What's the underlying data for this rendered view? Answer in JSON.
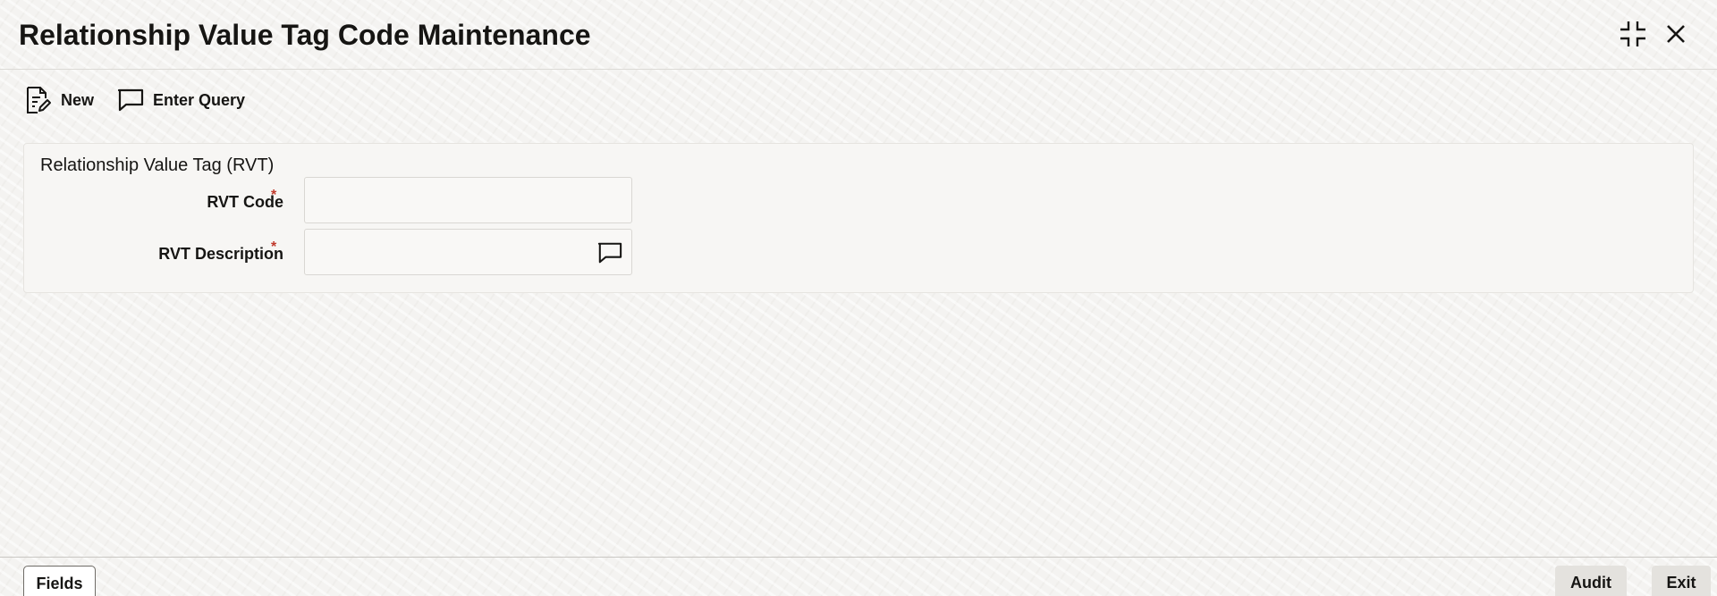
{
  "window": {
    "title": "Relationship Value Tag Code Maintenance",
    "maximize_icon": "maximize-icon",
    "close_icon": "close-icon"
  },
  "toolbar": {
    "new_label": "New",
    "new_icon": "new-document-icon",
    "enter_query_label": "Enter Query",
    "enter_query_icon": "comment-icon"
  },
  "panel": {
    "heading": "Relationship Value Tag (RVT)",
    "fields": [
      {
        "label": "RVT Code",
        "required_marker": "*",
        "value": ""
      },
      {
        "label": "RVT Description",
        "required_marker": "*",
        "value": "",
        "icon": "comment-icon"
      }
    ]
  },
  "footer": {
    "fields_label": "Fields",
    "audit_label": "Audit",
    "exit_label": "Exit"
  },
  "colors": {
    "required": "#c0392b",
    "text": "#161513",
    "background": "#f4f3f1"
  }
}
